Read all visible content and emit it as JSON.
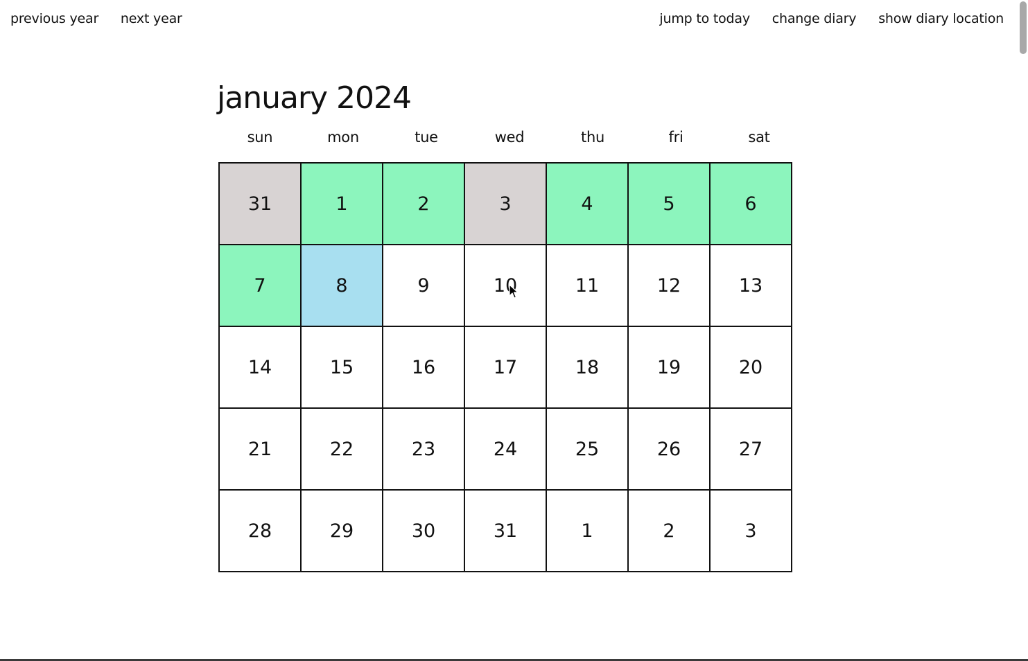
{
  "nav": {
    "previous_year": "previous year",
    "next_year": "next year",
    "jump_to_today": "jump to today",
    "change_diary": "change diary",
    "show_diary_location": "show diary location"
  },
  "calendar": {
    "title": "january 2024",
    "weekdays": [
      "sun",
      "mon",
      "tue",
      "wed",
      "thu",
      "fri",
      "sat"
    ],
    "weeks": [
      [
        {
          "day": "31",
          "status": "grey"
        },
        {
          "day": "1",
          "status": "green"
        },
        {
          "day": "2",
          "status": "green"
        },
        {
          "day": "3",
          "status": "grey"
        },
        {
          "day": "4",
          "status": "green"
        },
        {
          "day": "5",
          "status": "green"
        },
        {
          "day": "6",
          "status": "green"
        }
      ],
      [
        {
          "day": "7",
          "status": "green"
        },
        {
          "day": "8",
          "status": "blue"
        },
        {
          "day": "9",
          "status": "white"
        },
        {
          "day": "10",
          "status": "white"
        },
        {
          "day": "11",
          "status": "white"
        },
        {
          "day": "12",
          "status": "white"
        },
        {
          "day": "13",
          "status": "white"
        }
      ],
      [
        {
          "day": "14",
          "status": "white"
        },
        {
          "day": "15",
          "status": "white"
        },
        {
          "day": "16",
          "status": "white"
        },
        {
          "day": "17",
          "status": "white"
        },
        {
          "day": "18",
          "status": "white"
        },
        {
          "day": "19",
          "status": "white"
        },
        {
          "day": "20",
          "status": "white"
        }
      ],
      [
        {
          "day": "21",
          "status": "white"
        },
        {
          "day": "22",
          "status": "white"
        },
        {
          "day": "23",
          "status": "white"
        },
        {
          "day": "24",
          "status": "white"
        },
        {
          "day": "25",
          "status": "white"
        },
        {
          "day": "26",
          "status": "white"
        },
        {
          "day": "27",
          "status": "white"
        }
      ],
      [
        {
          "day": "28",
          "status": "white"
        },
        {
          "day": "29",
          "status": "white"
        },
        {
          "day": "30",
          "status": "white"
        },
        {
          "day": "31",
          "status": "white"
        },
        {
          "day": "1",
          "status": "white"
        },
        {
          "day": "2",
          "status": "white"
        },
        {
          "day": "3",
          "status": "white"
        }
      ]
    ]
  },
  "colors": {
    "grey": "#d8d3d3",
    "green": "#8cf5bd",
    "blue": "#a8dff0",
    "white": "#ffffff",
    "border": "#111111"
  },
  "icons": {
    "cursor": "mouse-pointer-icon"
  }
}
